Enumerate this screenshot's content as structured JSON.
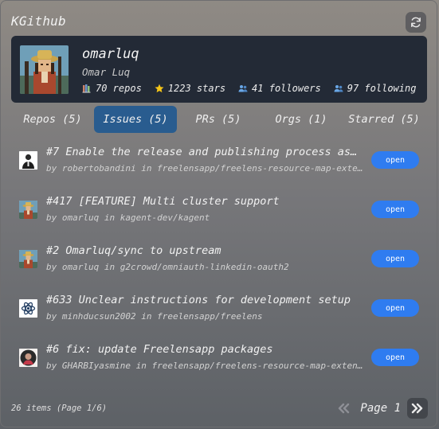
{
  "app": {
    "title": "KGithub"
  },
  "profile": {
    "username": "omarluq",
    "full_name": "Omar Luq",
    "stats": [
      {
        "icon": "books-icon",
        "text": "70 repos"
      },
      {
        "icon": "star-icon",
        "text": "1223 stars"
      },
      {
        "icon": "people-icon",
        "text": "41 followers"
      },
      {
        "icon": "people-icon",
        "text": "97 following"
      }
    ]
  },
  "tabs": [
    {
      "label": "Repos (5)",
      "active": false
    },
    {
      "label": "Issues (5)",
      "active": true
    },
    {
      "label": "PRs (5)",
      "active": false
    },
    {
      "label": "Orgs (1)",
      "active": false
    },
    {
      "label": "Starred (5)",
      "active": false
    }
  ],
  "issues": [
    {
      "title": "#7 Enable the release and publishing process as fo…",
      "meta": "by robertobandini in freelensapp/freelens-resource-map-exte…",
      "status": "open",
      "avatar": "robertobandini"
    },
    {
      "title": "#417 [FEATURE] Multi cluster support",
      "meta": "by omarluq in kagent-dev/kagent",
      "status": "open",
      "avatar": "omarluq"
    },
    {
      "title": "#2 Omarluq/sync to upstream",
      "meta": "by omarluq in g2crowd/omniauth-linkedin-oauth2",
      "status": "open",
      "avatar": "omarluq"
    },
    {
      "title": "#633 Unclear instructions for development setup",
      "meta": "by minhducsun2002 in freelensapp/freelens",
      "status": "open",
      "avatar": "minhducsun2002"
    },
    {
      "title": "#6 fix: update Freelensapp packages",
      "meta": "by GHARBIyasmine in freelensapp/freelens-resource-map-exten…",
      "status": "open",
      "avatar": "GHARBIyasmine"
    }
  ],
  "footer": {
    "count_text": "26 items (Page 1/6)",
    "page_label": "Page 1"
  },
  "colors": {
    "card_bg": "#232a36",
    "active_tab": "#295c8f",
    "status_open": "#2f7cf0"
  }
}
